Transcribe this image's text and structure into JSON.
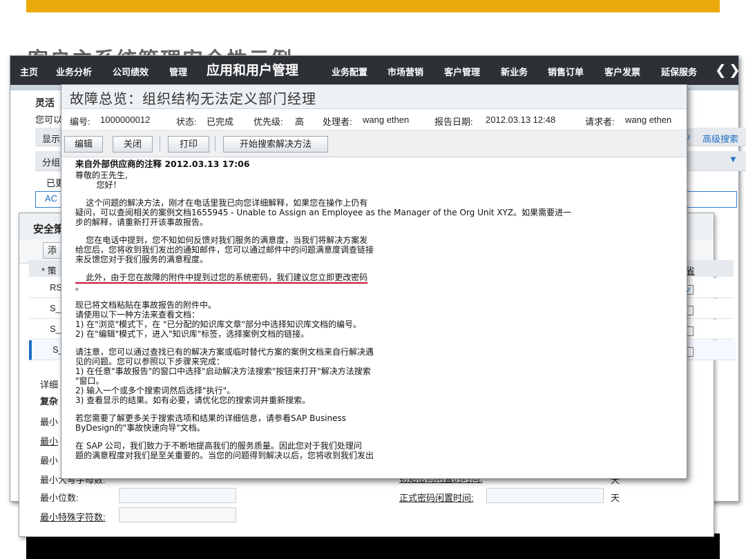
{
  "slide": {
    "title": "客户主系统管理安全性示例"
  },
  "nav": {
    "items": [
      "主页",
      "业务分析",
      "公司绩效",
      "管理",
      "应用和用户管理",
      "业务配置",
      "市场营销",
      "客户管理",
      "新业务",
      "销售订单",
      "客户发票",
      "延保服务"
    ],
    "active": "应用和用户管理",
    "prev": "❮",
    "next": "❯"
  },
  "bg": {
    "heading": "灵活",
    "subtext": "您可以",
    "show": "显示",
    "group": "分组",
    "status": "已更",
    "selected_value": "AC",
    "advanced_search": "高级搜索",
    "refresh_icon": "↻",
    "filter_icon": "▼"
  },
  "security": {
    "title": "安全策",
    "add_button": "添",
    "col_policy": "* 策",
    "col_default": "默省",
    "rows": [
      "RS",
      "S_",
      "S_",
      "S_"
    ],
    "details_label": "详细",
    "complex_label": "复杂",
    "left_labels": [
      "最小",
      "最小",
      "最小",
      "最小大写字母数:",
      "最小位数:",
      "最小特殊字符数:"
    ],
    "right_labels": [
      "初始密码闲置的时间:",
      "正式密码闲置时间:"
    ],
    "unit": "天"
  },
  "incident": {
    "title": "故障总览：组织结构无法定义部门经理",
    "id_label": "编号:",
    "id_value": "1000000012",
    "status_label": "状态:",
    "status_value": "已完成",
    "priority_label": "优先级:",
    "priority_value": "高",
    "processor_label": "处理者:",
    "processor_value": "wang ethen",
    "date_label": "报告日期:",
    "date_value": "2012.03.13 12:48",
    "requester_label": "请求者:",
    "requester_value": "wang ethen",
    "buttons": {
      "edit": "编辑",
      "close": "关闭",
      "print": "打印",
      "search": "开始搜索解决方法"
    },
    "note_header": "来自外部供应商的注释 2012.03.13 17:06",
    "greeting1": "尊敬的王先生,",
    "greeting2": "        您好！",
    "para1_l1": "    这个问题的解决方法，刚才在电话里我已向您详细解释，如果您在操作上仍有",
    "para1_l2": "疑问，可以查阅相关的案例文档1655945 - Unable to Assign an Employee as the Manager of the Org Unit XYZ。如果需要进一",
    "para1_l3": "步的解释，请重新打开该事故报告。",
    "para2_l1": "    您在电话中提到，您不知如何反馈对我们服务的满意度，当我们将解决方案发",
    "para2_l2": "给您后，您将收到我们发出的通知邮件，您可以通过邮件中的问题满意度调查链接",
    "para2_l3": "来反馈您对于我们服务的满意程度。",
    "highlight": "    此外，由于您在故障的附件中提到过您的系统密码，我们建议您立即更改密码",
    "dot": "。",
    "para3_l1": "现已将文档粘贴在事故报告的附件中。",
    "para3_l2": "请使用以下一种方法来查看文档：",
    "para3_l3": "1) 在\"浏览\"模式下，在 \"已分配的知识库文章\"部分中选择知识库文档的编号。",
    "para3_l4": "2) 在\"编辑\"模式下，进入\"知识库\"标签，选择案例文档的链接。",
    "para4_l1": "请注意，您可以通过查找已有的解决方案或临时替代方案的案例文档来自行解决遇",
    "para4_l2": "见的问题。您可以参照以下步骤来完成：",
    "para4_l3": "1) 在任意\"事故报告\"的窗口中选择\"启动解决方法搜索\"按钮来打开\"解决方法搜索",
    "para4_l4": "\"窗口。",
    "para4_l5": "2) 输入一个或多个搜索词然后选择\"执行\"。",
    "para4_l6": "3) 查看显示的结果。如有必要，请优化您的搜索词并重新搜索。",
    "para5_l1": "若您需要了解更多关于搜索选项和结果的详细信息，请参看SAP Business",
    "para5_l2": "ByDesign的\"事故快速向导\"文档。",
    "para6_l1": "在 SAP 公司，我们致力于不断地提高我们的服务质量。因此您对于我们处理问",
    "para6_l2": "题的满意程度对我们是至关重要的。当您的问题得到解决以后，您将收到我们发出"
  }
}
